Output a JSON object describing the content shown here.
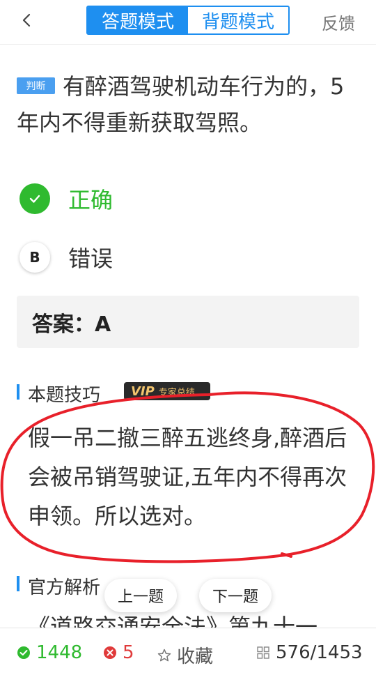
{
  "header": {
    "back_icon": "chevron-left-icon",
    "tabs": [
      {
        "label": "答题模式",
        "active": true
      },
      {
        "label": "背题模式",
        "active": false
      }
    ],
    "feedback_label": "反馈"
  },
  "question": {
    "type_badge": "判断",
    "text": "有醉酒驾驶机动车行为的，5年内不得重新获取驾照。"
  },
  "options": [
    {
      "marker": "check-icon",
      "label": "正确",
      "state": "correct"
    },
    {
      "marker": "B",
      "label": "错误",
      "state": "plain"
    }
  ],
  "answer": {
    "text": "答案：A"
  },
  "skill": {
    "title": "本题技巧",
    "vip_logo": "VIP",
    "vip_text": "专家总结",
    "text": "假一吊二撤三醉五逃终身,醉酒后会被吊销驾驶证,五年内不得再次申领。所以选对。"
  },
  "official": {
    "title": "官方解析",
    "text": "《道路交通安全法》第九十一"
  },
  "nav": {
    "prev_label": "上一题",
    "next_label": "下一题"
  },
  "bottom": {
    "right_count": "1448",
    "wrong_count": "5",
    "collect_label": "收藏",
    "progress": "576/1453"
  },
  "colors": {
    "accent": "#1e8ff0",
    "correct": "#2fba2f",
    "wrong": "#e03a3a",
    "annotation": "#e8202a"
  }
}
